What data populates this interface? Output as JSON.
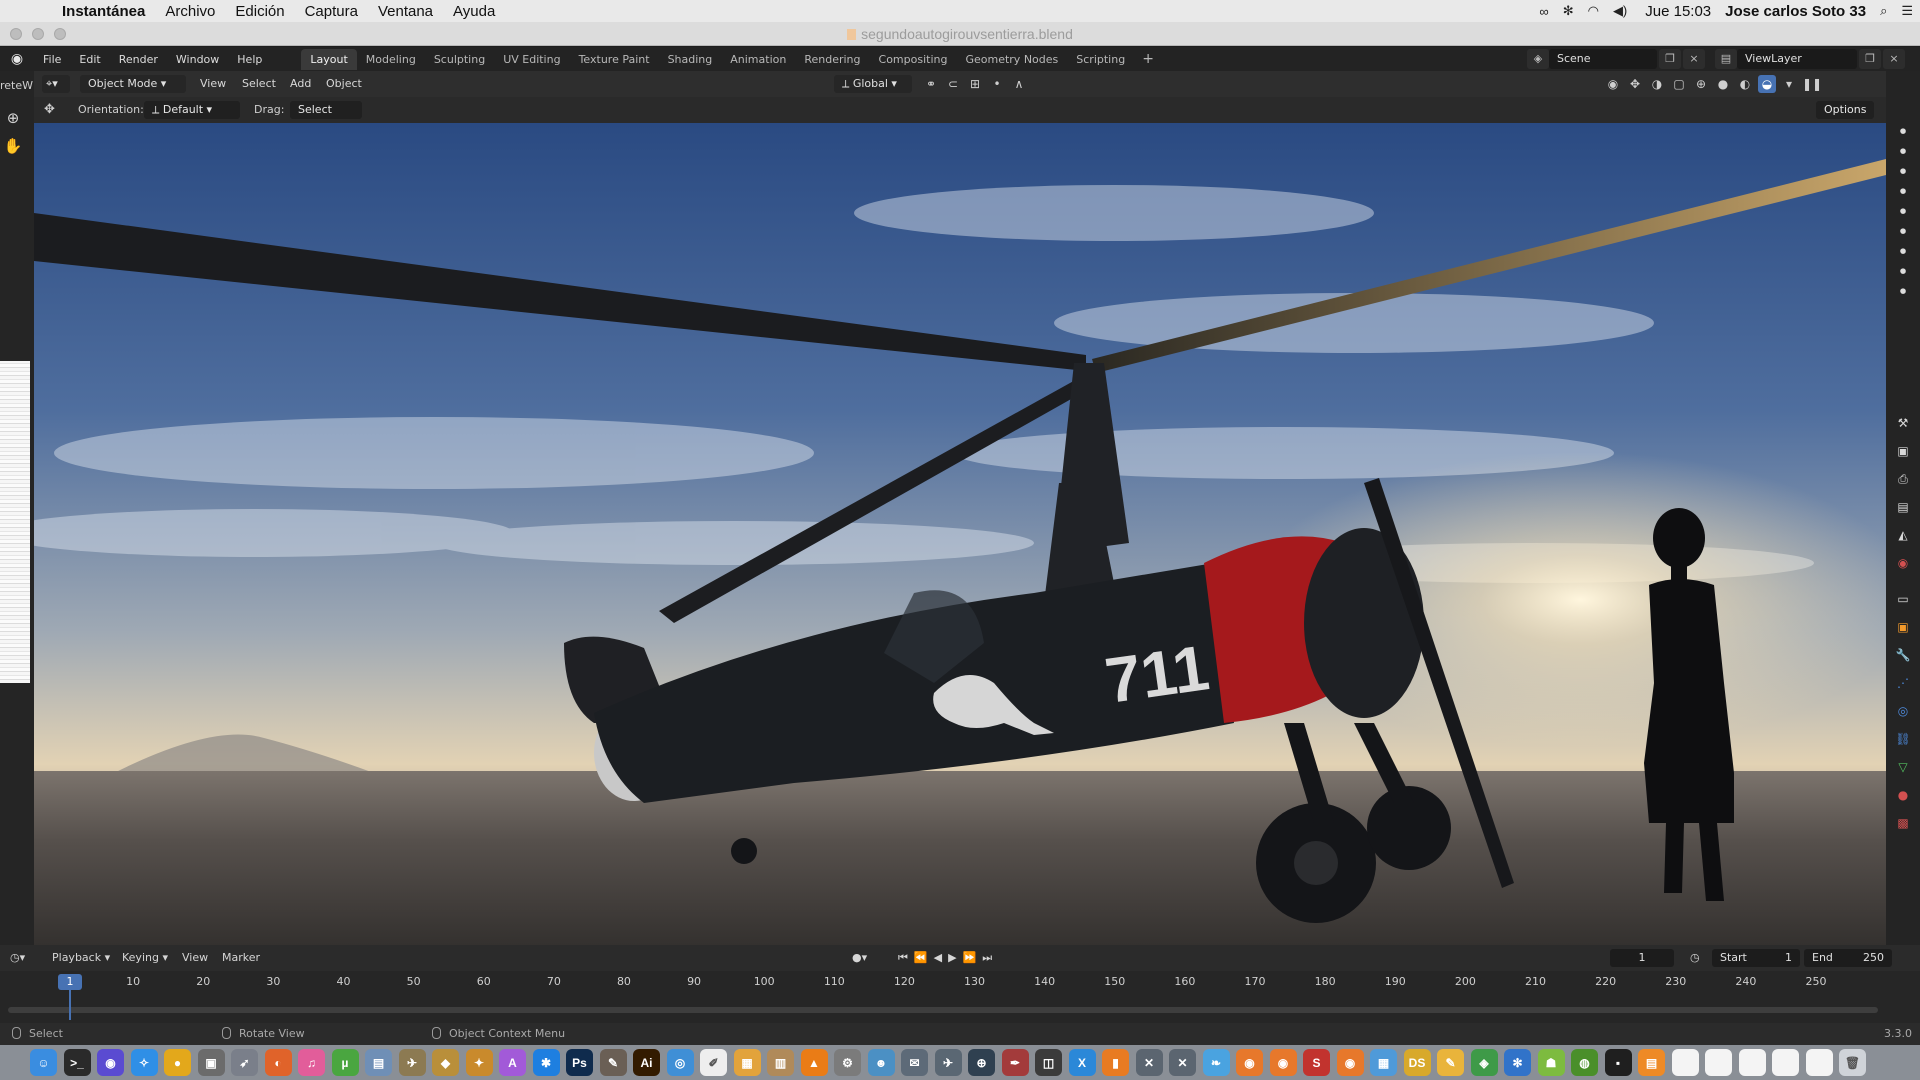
{
  "macos": {
    "menubar": {
      "app_name": "Instantánea",
      "menus": [
        "Archivo",
        "Edición",
        "Captura",
        "Ventana",
        "Ayuda"
      ],
      "clock": "Jue 15:03",
      "user": "Jose carlos Soto 33"
    },
    "window_title": "segundoautogirouvsentierra.blend",
    "dock": {
      "items": [
        {
          "name": "finder",
          "color": "#3a8de0",
          "glyph": "☺"
        },
        {
          "name": "terminal",
          "color": "#2a2a2a",
          "glyph": ">_"
        },
        {
          "name": "siri",
          "color": "#5a4bd1",
          "glyph": "◉"
        },
        {
          "name": "safari",
          "color": "#2f8fe6",
          "glyph": "✧"
        },
        {
          "name": "chrome",
          "color": "#e3a81b",
          "glyph": "●"
        },
        {
          "name": "image-capture",
          "color": "#6b6b6b",
          "glyph": "▣"
        },
        {
          "name": "launchpad",
          "color": "#7a7f8a",
          "glyph": "➶"
        },
        {
          "name": "firefox",
          "color": "#e0632a",
          "glyph": "◐"
        },
        {
          "name": "itunes",
          "color": "#e25d9a",
          "glyph": "♫"
        },
        {
          "name": "utorrent",
          "color": "#4aa640",
          "glyph": "µ"
        },
        {
          "name": "preview",
          "color": "#6f8fb6",
          "glyph": "▤"
        },
        {
          "name": "photos-app",
          "color": "#8c7a52",
          "glyph": "✈"
        },
        {
          "name": "sketchup",
          "color": "#b98f3a",
          "glyph": "◆"
        },
        {
          "name": "poser",
          "color": "#c98a2c",
          "glyph": "✦"
        },
        {
          "name": "affinity",
          "color": "#a25ad8",
          "glyph": "A"
        },
        {
          "name": "app-store",
          "color": "#1e7fe0",
          "glyph": "✱"
        },
        {
          "name": "photoshop",
          "color": "#0f2b4d",
          "glyph": "Ps"
        },
        {
          "name": "gimp",
          "color": "#6a5f55",
          "glyph": "✎"
        },
        {
          "name": "illustrator",
          "color": "#331b00",
          "glyph": "Ai"
        },
        {
          "name": "network-utility",
          "color": "#3f8fd6",
          "glyph": "◎"
        },
        {
          "name": "textedit",
          "color": "#eeeeee",
          "glyph": "✐"
        },
        {
          "name": "keynote",
          "color": "#e2a33b",
          "glyph": "▦"
        },
        {
          "name": "archive",
          "color": "#b08a5a",
          "glyph": "▥"
        },
        {
          "name": "vlc",
          "color": "#ea7c16",
          "glyph": "▲"
        },
        {
          "name": "system-prefs",
          "color": "#7b7b7b",
          "glyph": "⚙"
        },
        {
          "name": "character",
          "color": "#4b90c4",
          "glyph": "☻"
        },
        {
          "name": "mail",
          "color": "#5d6a78",
          "glyph": "✉"
        },
        {
          "name": "jet",
          "color": "#5a6773",
          "glyph": "✈"
        },
        {
          "name": "magnifier",
          "color": "#2f4050",
          "glyph": "⊕"
        },
        {
          "name": "pen",
          "color": "#a33b3b",
          "glyph": "✒"
        },
        {
          "name": "screenflow",
          "color": "#3b3b3b",
          "glyph": "◫"
        },
        {
          "name": "xcode",
          "color": "#2b88d8",
          "glyph": "X"
        },
        {
          "name": "books",
          "color": "#e87b22",
          "glyph": "▮"
        },
        {
          "name": "figure-1",
          "color": "#5b6570",
          "glyph": "✕"
        },
        {
          "name": "figure-2",
          "color": "#5b6570",
          "glyph": "✕"
        },
        {
          "name": "feather",
          "color": "#4aa3e0",
          "glyph": "❧"
        },
        {
          "name": "blender-1",
          "color": "#e7782b",
          "glyph": "◉"
        },
        {
          "name": "blender-2",
          "color": "#e7782b",
          "glyph": "◉"
        },
        {
          "name": "substance",
          "color": "#c2332e",
          "glyph": "S"
        },
        {
          "name": "blender-3",
          "color": "#e7782b",
          "glyph": "◉"
        },
        {
          "name": "folder-app",
          "color": "#4f9ad9",
          "glyph": "▦"
        },
        {
          "name": "daz-studio",
          "color": "#d8a92b",
          "glyph": "DS"
        },
        {
          "name": "notes",
          "color": "#e9b43b",
          "glyph": "✎"
        },
        {
          "name": "maps",
          "color": "#3e9a48",
          "glyph": "◈"
        },
        {
          "name": "bluetooth",
          "color": "#3173c9",
          "glyph": "✻"
        },
        {
          "name": "android",
          "color": "#7dbb3f",
          "glyph": "☗"
        },
        {
          "name": "geo",
          "color": "#4a8f2a",
          "glyph": "◍"
        },
        {
          "name": "terminal-2",
          "color": "#1f1f1f",
          "glyph": "▪"
        },
        {
          "name": "downloads",
          "color": "#ee8a26",
          "glyph": "▤"
        },
        {
          "name": "document-1",
          "color": "#f4f4f4",
          "glyph": ""
        },
        {
          "name": "document-2",
          "color": "#f4f4f4",
          "glyph": ""
        },
        {
          "name": "document-3",
          "color": "#f4f4f4",
          "glyph": ""
        },
        {
          "name": "document-4",
          "color": "#f4f4f4",
          "glyph": ""
        },
        {
          "name": "document-5",
          "color": "#f4f4f4",
          "glyph": ""
        },
        {
          "name": "trash",
          "color": "#cfd3d8",
          "glyph": "🗑"
        }
      ]
    }
  },
  "blender": {
    "topbar": {
      "menus": [
        "File",
        "Edit",
        "Render",
        "Window",
        "Help"
      ],
      "workspaces": [
        "Layout",
        "Modeling",
        "Sculpting",
        "UV Editing",
        "Texture Paint",
        "Shading",
        "Animation",
        "Rendering",
        "Compositing",
        "Geometry Nodes",
        "Scripting"
      ],
      "active_workspace": "Layout",
      "scene": "Scene",
      "view_layer": "ViewLayer"
    },
    "left_tab_label": "reteW",
    "viewport_header": {
      "mode": "Object Mode",
      "menus": [
        "View",
        "Select",
        "Add",
        "Object"
      ],
      "transform_orientation": "Global"
    },
    "tool_settings": {
      "orientation_label": "Orientation:",
      "orientation_value": "Default",
      "drag_label": "Drag:",
      "drag_value": "Select Box",
      "options_label": "Options"
    },
    "scene_render": {
      "aircraft_number": "711",
      "sky_top": "#2f4e86",
      "sky_horizon": "#e2d2b4",
      "sun_color": "#fff6de",
      "cowling_color": "#a5191c",
      "fuselage_color": "#1b1e22"
    },
    "timeline": {
      "menus": [
        "Playback",
        "Keying",
        "View",
        "Marker"
      ],
      "current_frame": "1",
      "start_label": "Start",
      "start_value": "1",
      "end_label": "End",
      "end_value": "250",
      "ruler_ticks": [
        "1",
        "10",
        "20",
        "30",
        "40",
        "50",
        "60",
        "70",
        "80",
        "90",
        "100",
        "110",
        "120",
        "130",
        "140",
        "150",
        "160",
        "170",
        "180",
        "190",
        "200",
        "210",
        "220",
        "230",
        "240",
        "250"
      ]
    },
    "statusbar": {
      "select": "Select",
      "rotate_view": "Rotate View",
      "context_menu": "Object Context Menu",
      "version": "3.3.0"
    }
  }
}
